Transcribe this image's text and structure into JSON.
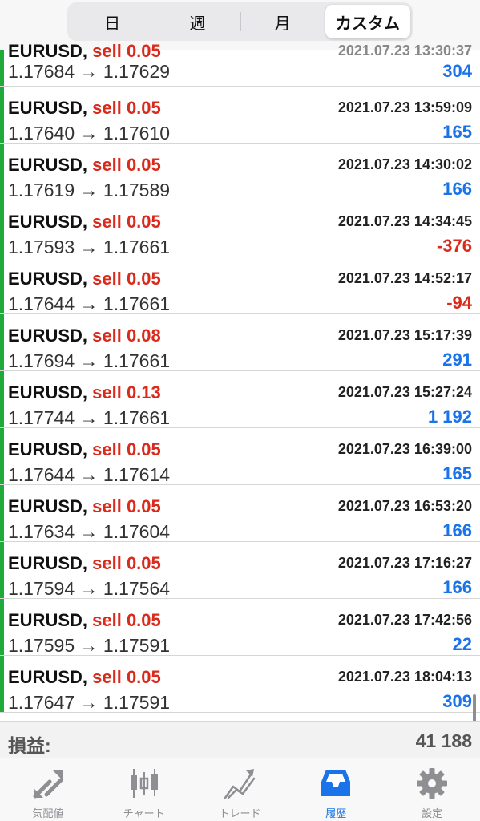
{
  "period_tabs": [
    {
      "label": "日",
      "active": false
    },
    {
      "label": "週",
      "active": false
    },
    {
      "label": "月",
      "active": false
    },
    {
      "label": "カスタム",
      "active": true
    }
  ],
  "trades": [
    {
      "symbol": "EURUSD,",
      "side": "sell 0.05",
      "time": "2021.07.23 13:30:37",
      "open": "1.17684",
      "close": "1.17629",
      "profit": "304",
      "negative": false,
      "partial": true
    },
    {
      "symbol": "EURUSD,",
      "side": "sell 0.05",
      "time": "2021.07.23 13:59:09",
      "open": "1.17640",
      "close": "1.17610",
      "profit": "165",
      "negative": false
    },
    {
      "symbol": "EURUSD,",
      "side": "sell 0.05",
      "time": "2021.07.23 14:30:02",
      "open": "1.17619",
      "close": "1.17589",
      "profit": "166",
      "negative": false
    },
    {
      "symbol": "EURUSD,",
      "side": "sell 0.05",
      "time": "2021.07.23 14:34:45",
      "open": "1.17593",
      "close": "1.17661",
      "profit": "-376",
      "negative": true
    },
    {
      "symbol": "EURUSD,",
      "side": "sell 0.05",
      "time": "2021.07.23 14:52:17",
      "open": "1.17644",
      "close": "1.17661",
      "profit": "-94",
      "negative": true
    },
    {
      "symbol": "EURUSD,",
      "side": "sell 0.08",
      "time": "2021.07.23 15:17:39",
      "open": "1.17694",
      "close": "1.17661",
      "profit": "291",
      "negative": false
    },
    {
      "symbol": "EURUSD,",
      "side": "sell 0.13",
      "time": "2021.07.23 15:27:24",
      "open": "1.17744",
      "close": "1.17661",
      "profit": "1 192",
      "negative": false
    },
    {
      "symbol": "EURUSD,",
      "side": "sell 0.05",
      "time": "2021.07.23 16:39:00",
      "open": "1.17644",
      "close": "1.17614",
      "profit": "165",
      "negative": false
    },
    {
      "symbol": "EURUSD,",
      "side": "sell 0.05",
      "time": "2021.07.23 16:53:20",
      "open": "1.17634",
      "close": "1.17604",
      "profit": "166",
      "negative": false
    },
    {
      "symbol": "EURUSD,",
      "side": "sell 0.05",
      "time": "2021.07.23 17:16:27",
      "open": "1.17594",
      "close": "1.17564",
      "profit": "166",
      "negative": false
    },
    {
      "symbol": "EURUSD,",
      "side": "sell 0.05",
      "time": "2021.07.23 17:42:56",
      "open": "1.17595",
      "close": "1.17591",
      "profit": "22",
      "negative": false
    },
    {
      "symbol": "EURUSD,",
      "side": "sell 0.05",
      "time": "2021.07.23 18:04:13",
      "open": "1.17647",
      "close": "1.17591",
      "profit": "309",
      "negative": false
    }
  ],
  "arrow": "→",
  "summary": {
    "label": "損益:",
    "value": "41 188"
  },
  "tabbar": [
    {
      "label": "気配値",
      "icon": "quotes-icon",
      "active": false
    },
    {
      "label": "チャート",
      "icon": "chart-icon",
      "active": false
    },
    {
      "label": "トレード",
      "icon": "trade-icon",
      "active": false
    },
    {
      "label": "履歴",
      "icon": "history-icon",
      "active": true
    },
    {
      "label": "設定",
      "icon": "settings-icon",
      "active": false
    }
  ],
  "colors": {
    "positive": "#1a73e8",
    "negative": "#d92a1c",
    "position_bar": "#1faa3a",
    "active_tab": "#1a73e8",
    "inactive_tab": "#8e8e93"
  }
}
